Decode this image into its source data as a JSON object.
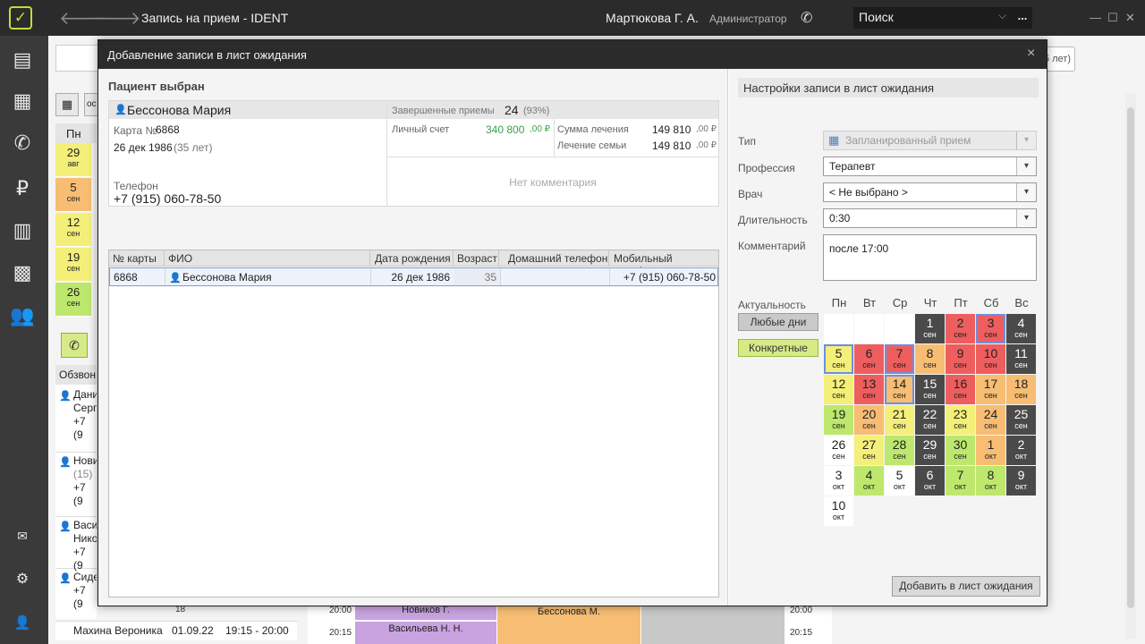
{
  "titlebar": {
    "app_title": "Запись на прием  -  IDENT",
    "user_name": "Мартюкова Г. А.",
    "user_role": "Администратор",
    "search_label": "Поиск",
    "search_more": "..."
  },
  "background": {
    "age_hint": "5 лет)",
    "day_header": "Пн",
    "calendar_btn2": "ос",
    "days": [
      {
        "num": "29",
        "mon": "авг",
        "color": "#f4ef79"
      },
      {
        "num": "5",
        "mon": "сен",
        "color": "#f7bd73"
      },
      {
        "num": "12",
        "mon": "сен",
        "color": "#f4ef79"
      },
      {
        "num": "19",
        "mon": "сен",
        "color": "#f4ef79"
      },
      {
        "num": "26",
        "mon": "сен",
        "color": "#bde86d"
      }
    ],
    "call_list_title": "Обзвон",
    "call_list": [
      {
        "line1": "Дани",
        "line2": "Серг",
        "line3": "+7 (9"
      },
      {
        "line1": "Нови",
        "line2": "(15)",
        "line3": "+7 (9"
      },
      {
        "line1": "Васи",
        "line2": "Нико",
        "line3": "+7 (9"
      },
      {
        "line1": "Сиде",
        "line2": "",
        "line3": "+7 (9"
      }
    ],
    "bottom_row": {
      "name": "Махина Вероника",
      "date": "01.09.22",
      "time": "19:15 - 20:00"
    },
    "schedule": {
      "t1": "20:00",
      "t2": "20:15",
      "t3": "20:00",
      "t4": "20:15",
      "n1": "Новиков Г.",
      "n2": "Васильева Н. Н.",
      "n3": "Бессонова М.",
      "n4": "18"
    }
  },
  "modal": {
    "title": "Добавление записи в лист ожидания",
    "close": "×",
    "patient_section_title": "Пациент выбран",
    "patient": {
      "name": "Бессонова Мария",
      "card_label": "Карта №",
      "card_number": "6868",
      "dob": "26 дек 1986",
      "age": "(35 лет)",
      "phone_label": "Телефон",
      "phone": "+7 (915) 060-78-50",
      "visits_label": "Завершенные приемы",
      "visits": "24",
      "visits_pct": "(93%)",
      "account_label": "Личный счет",
      "account": "340 800",
      "account_cur": ",00 ₽",
      "treatment_sum_label": "Сумма лечения",
      "treatment_sum": "149 810",
      "treatment_sum_cur": ",00 ₽",
      "family_label": "Лечение семьи",
      "family_sum": "149 810",
      "family_sum_cur": ",00 ₽",
      "no_comment": "Нет комментария"
    },
    "grid": {
      "headers": [
        "№ карты",
        "ФИО",
        "Дата рождения",
        "Возраст",
        "Домашний телефон",
        "Мобильный телефон"
      ],
      "rows": [
        {
          "card": "6868",
          "name": "Бессонова Мария",
          "dob": "26 дек 1986",
          "age": "35",
          "home": "",
          "mobile": "+7 (915) 060-78-50"
        }
      ]
    },
    "settings": {
      "title": "Настройки записи в лист ожидания",
      "type_label": "Тип",
      "type_value": "Запланированный прием",
      "profession_label": "Профессия",
      "profession_value": "Терапевт",
      "doctor_label": "Врач",
      "doctor_value": "< Не выбрано >",
      "duration_label": "Длительность",
      "duration_value": "0:30",
      "comment_label": "Комментарий",
      "comment_value": "после 17:00",
      "relevance_label": "Актуальность",
      "any_days": "Любые дни",
      "specific_days": "Конкретные",
      "add_button": "Добавить в лист ожидания"
    },
    "calendar": {
      "weekdays": [
        "Пн",
        "Вт",
        "Ср",
        "Чт",
        "Пт",
        "Сб",
        "Вс"
      ],
      "weeks": [
        [
          {
            "d": "",
            "m": "",
            "c": "empty"
          },
          {
            "d": "",
            "m": "",
            "c": "empty"
          },
          {
            "d": "",
            "m": "",
            "c": "empty"
          },
          {
            "d": "1",
            "m": "сен",
            "c": "dark"
          },
          {
            "d": "2",
            "m": "сен",
            "c": "red"
          },
          {
            "d": "3",
            "m": "сен",
            "c": "red",
            "sel": true
          },
          {
            "d": "4",
            "m": "сен",
            "c": "dark"
          }
        ],
        [
          {
            "d": "5",
            "m": "сен",
            "c": "yellow",
            "sel": true
          },
          {
            "d": "6",
            "m": "сен",
            "c": "red"
          },
          {
            "d": "7",
            "m": "сен",
            "c": "red",
            "sel": true
          },
          {
            "d": "8",
            "m": "сен",
            "c": "orange"
          },
          {
            "d": "9",
            "m": "сен",
            "c": "red"
          },
          {
            "d": "10",
            "m": "сен",
            "c": "red"
          },
          {
            "d": "11",
            "m": "сен",
            "c": "dark"
          }
        ],
        [
          {
            "d": "12",
            "m": "сен",
            "c": "yellow"
          },
          {
            "d": "13",
            "m": "сен",
            "c": "red"
          },
          {
            "d": "14",
            "m": "сен",
            "c": "orange",
            "sel": true
          },
          {
            "d": "15",
            "m": "сен",
            "c": "dark"
          },
          {
            "d": "16",
            "m": "сен",
            "c": "red"
          },
          {
            "d": "17",
            "m": "сен",
            "c": "orange"
          },
          {
            "d": "18",
            "m": "сен",
            "c": "orange"
          }
        ],
        [
          {
            "d": "19",
            "m": "сен",
            "c": "green"
          },
          {
            "d": "20",
            "m": "сен",
            "c": "orange"
          },
          {
            "d": "21",
            "m": "сен",
            "c": "yellow"
          },
          {
            "d": "22",
            "m": "сен",
            "c": "dark"
          },
          {
            "d": "23",
            "m": "сен",
            "c": "yellow"
          },
          {
            "d": "24",
            "m": "сен",
            "c": "orange"
          },
          {
            "d": "25",
            "m": "сен",
            "c": "dark"
          }
        ],
        [
          {
            "d": "26",
            "m": "сен",
            "c": "white"
          },
          {
            "d": "27",
            "m": "сен",
            "c": "yellow"
          },
          {
            "d": "28",
            "m": "сен",
            "c": "green"
          },
          {
            "d": "29",
            "m": "сен",
            "c": "dark"
          },
          {
            "d": "30",
            "m": "сен",
            "c": "green"
          },
          {
            "d": "1",
            "m": "окт",
            "c": "orange"
          },
          {
            "d": "2",
            "m": "окт",
            "c": "dark"
          }
        ],
        [
          {
            "d": "3",
            "m": "окт",
            "c": "white"
          },
          {
            "d": "4",
            "m": "окт",
            "c": "green"
          },
          {
            "d": "5",
            "m": "окт",
            "c": "white"
          },
          {
            "d": "6",
            "m": "окт",
            "c": "dark"
          },
          {
            "d": "7",
            "m": "окт",
            "c": "green"
          },
          {
            "d": "8",
            "m": "окт",
            "c": "green"
          },
          {
            "d": "9",
            "m": "окт",
            "c": "dark"
          }
        ],
        [
          {
            "d": "10",
            "m": "окт",
            "c": "white"
          }
        ]
      ]
    }
  },
  "colors": {
    "accent_green": "#bde86d",
    "dark": "#2b2b2b",
    "red": "#ee5e5e",
    "orange": "#f7bd73",
    "yellow": "#f4ef79",
    "selection": "#6c8fe0"
  }
}
